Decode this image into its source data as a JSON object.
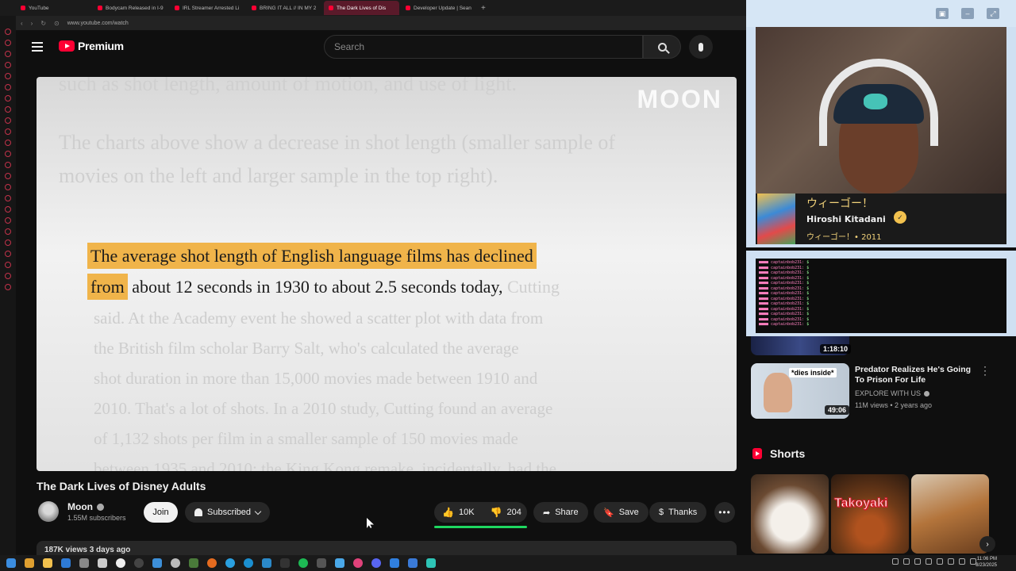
{
  "browser": {
    "tabs": [
      {
        "label": "YouTube",
        "active": false
      },
      {
        "label": "Bodycam Released in I-9",
        "active": false
      },
      {
        "label": "IRL Streamer Arrested Li",
        "active": false
      },
      {
        "label": "BRING IT ALL // IN MY 2",
        "active": false
      },
      {
        "label": "The Dark Lives of Dis",
        "active": true
      },
      {
        "label": "Developer Update | Sean",
        "active": false
      }
    ],
    "new_tab_label": "+",
    "url": "www.youtube.com/watch"
  },
  "header": {
    "logo_text": "Premium",
    "search_placeholder": "Search"
  },
  "video": {
    "watermark": "MOON",
    "faint_lines": [
      "such as shot length, amount of motion, and use of light.",
      "The charts above show a decrease in shot length (smaller sample of",
      "movies on the left and larger sample in the top right)."
    ],
    "highlight_line1": "The average shot length of English language films has declined",
    "highlight_line2_mark": "from",
    "highlight_line2_rest": " about 12 seconds in 1930 to about 2.5 seconds today,",
    "highlight_line2_gray": " Cutting",
    "body_lines": [
      "said. At the Academy event he showed a scatter plot with data from",
      "the British film scholar Barry Salt, who's calculated the average",
      "shot duration in more than 15,000 movies made between 1910 and",
      "2010. That's a lot of shots. In a 2010 study, Cutting found an average",
      "of 1,132 shots per film in a smaller sample of 150 movies made",
      "between 1935 and 2010; the King Kong remake, incidentally, had the"
    ],
    "title": "The Dark Lives of Disney Adults"
  },
  "channel": {
    "name": "Moon",
    "subscribers": "1.55M subscribers",
    "join_label": "Join",
    "subscribed_label": "Subscribed"
  },
  "actions": {
    "likes": "10K",
    "dislikes": "204",
    "share": "Share",
    "save": "Save",
    "thanks": "Thanks",
    "more": "•••"
  },
  "description": {
    "views_line": "187K views  3 days ago"
  },
  "stream": {
    "now_playing_title": "ウィーゴー！",
    "now_playing_artist": "Hiroshi Kitadani",
    "now_playing_sub": "ウィーゴー！• 2011",
    "chat_user": "captainbob231:",
    "chat_lines": 13
  },
  "recommendations": [
    {
      "duration": "1:18:10"
    },
    {
      "title": "Predator Realizes He's Going To Prison For Life",
      "channel": "EXPLORE WITH US",
      "meta": "11M views • 2 years ago",
      "duration": "49:06",
      "thumb_caption": "*dies inside*"
    }
  ],
  "shorts": {
    "title": "Shorts",
    "items": [
      {
        "label": ""
      },
      {
        "label": "Takoyaki"
      },
      {
        "label": ""
      }
    ]
  },
  "taskbar": {
    "time": "11:06 PM",
    "date": "8/23/2025"
  },
  "colors": {
    "brand_red": "#ff0033",
    "highlight": "#f0b44a",
    "like_bar": "#1ed760"
  }
}
